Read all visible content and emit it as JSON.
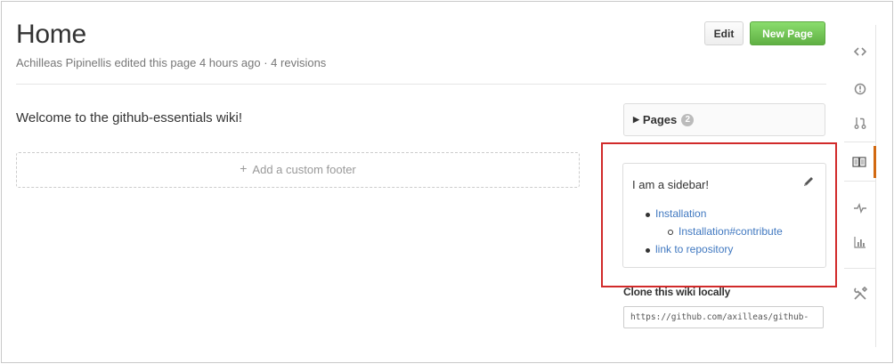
{
  "page": {
    "title": "Home",
    "meta": "Achilleas Pipinellis edited this page 4 hours ago · 4 revisions"
  },
  "actions": {
    "edit_label": "Edit",
    "new_page_label": "New Page"
  },
  "content": {
    "welcome_text": "Welcome to the github-essentials wiki!",
    "add_footer_label": "Add a custom footer"
  },
  "pages": {
    "label": "Pages",
    "count": "2"
  },
  "sidebar": {
    "text": "I am a sidebar!",
    "links": [
      {
        "label": "Installation"
      },
      {
        "label": "Installation#contribute"
      },
      {
        "label": "link to repository"
      }
    ]
  },
  "clone": {
    "label": "Clone this wiki locally",
    "url": "https://github.com/axilleas/github-"
  },
  "repo_nav": {
    "items": [
      {
        "icon": "code-icon"
      },
      {
        "icon": "issue-icon"
      },
      {
        "icon": "pull-request-icon"
      },
      {
        "icon": "book-icon",
        "active": true
      },
      {
        "icon": "pulse-icon"
      },
      {
        "icon": "graph-icon"
      },
      {
        "icon": "tools-icon"
      }
    ]
  },
  "colors": {
    "accent_green": "#60b044",
    "link_blue": "#4078c0",
    "highlight_red": "#d12a2a",
    "active_tab": "#d26911"
  }
}
